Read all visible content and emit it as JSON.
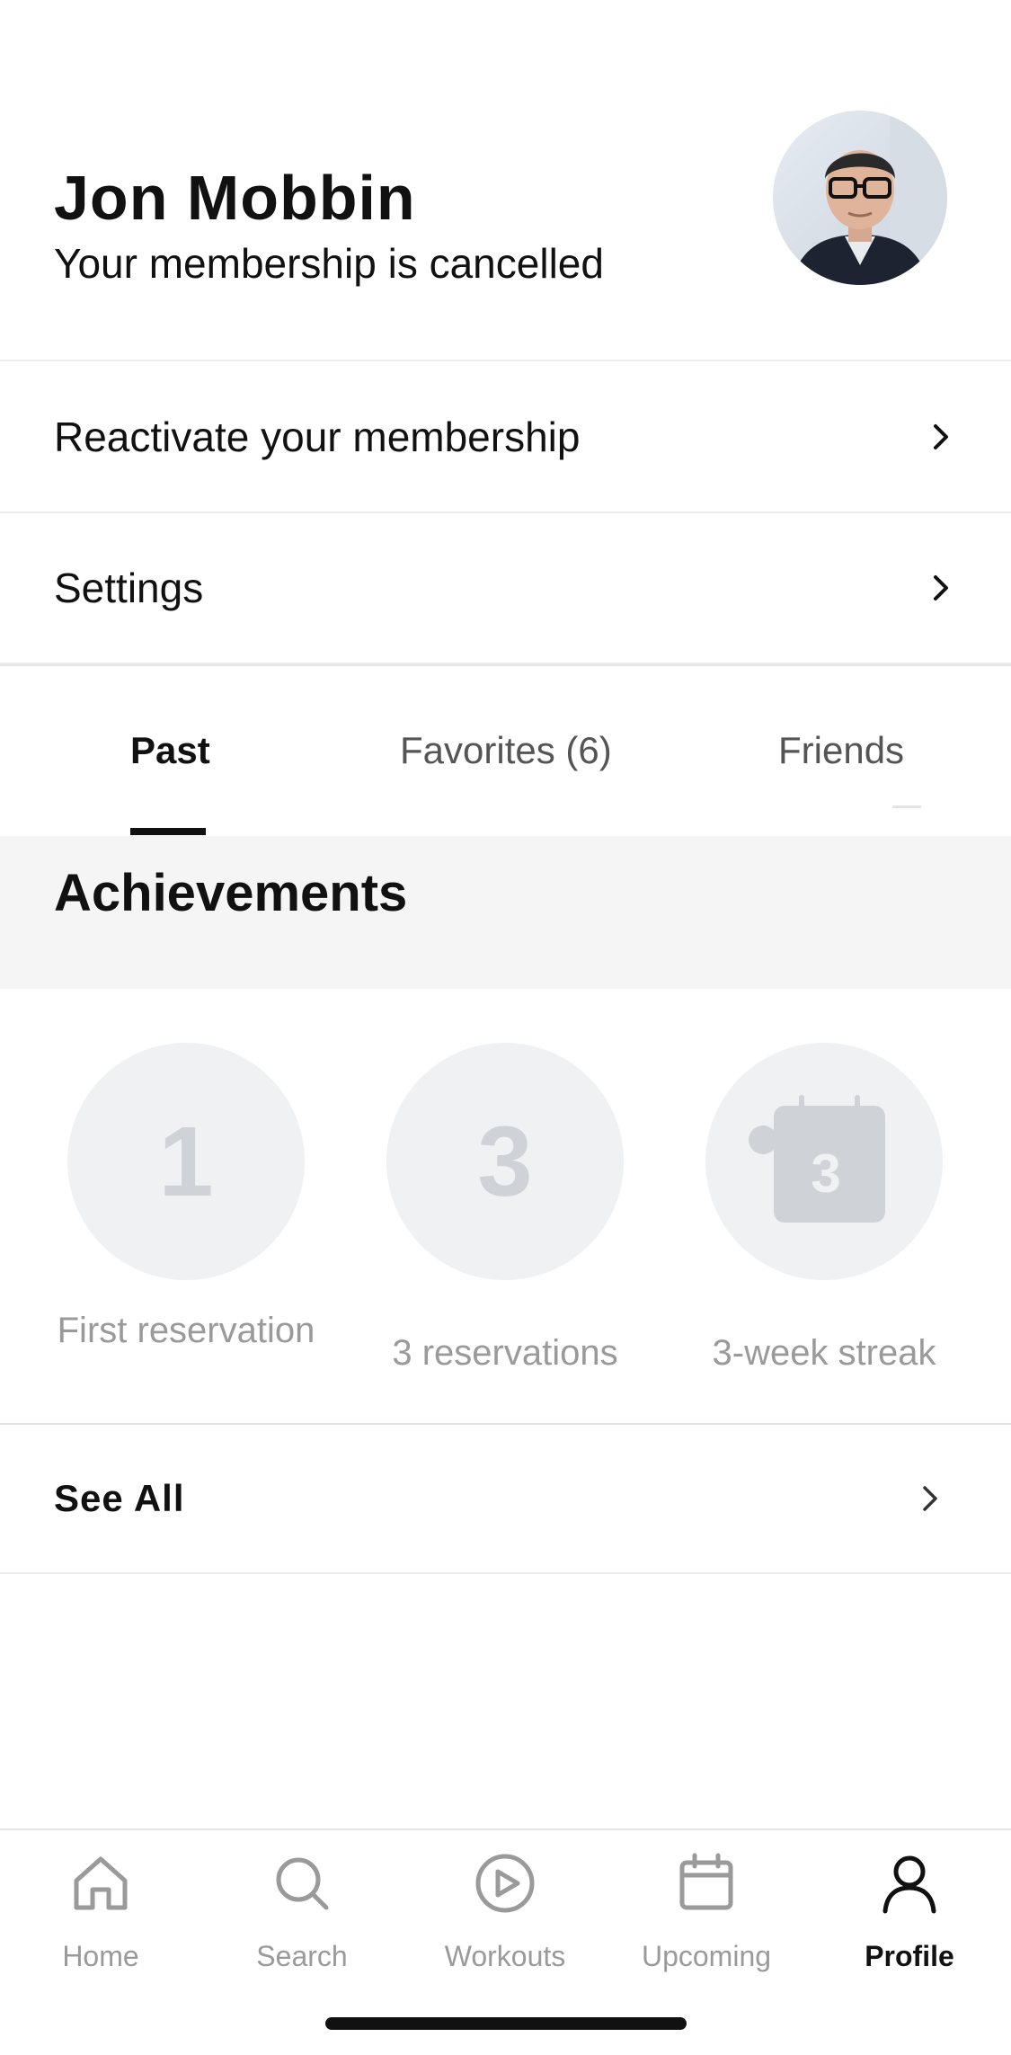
{
  "profile": {
    "name": "Jon Mobbin",
    "membership_status": "Your membership is cancelled",
    "avatar_icon": "user-photo"
  },
  "menu": {
    "reactivate_label": "Reactivate your membership",
    "settings_label": "Settings"
  },
  "tabs": [
    {
      "label": "Past",
      "active": true
    },
    {
      "label": "Favorites (6)",
      "active": false
    },
    {
      "label": "Friends",
      "active": false
    }
  ],
  "achievements": {
    "title": "Achievements",
    "items": [
      {
        "badge": "1",
        "label": "First reservation"
      },
      {
        "badge": "3",
        "label": "3 reservations"
      },
      {
        "badge": "3",
        "label": "3-week streak",
        "icon": "calendar-icon"
      }
    ],
    "see_all_label": "See All"
  },
  "nav": {
    "items": [
      {
        "label": "Home",
        "icon": "home-icon",
        "active": false
      },
      {
        "label": "Search",
        "icon": "search-icon",
        "active": false
      },
      {
        "label": "Workouts",
        "icon": "play-circle-icon",
        "active": false
      },
      {
        "label": "Upcoming",
        "icon": "calendar-icon",
        "active": false
      },
      {
        "label": "Profile",
        "icon": "person-icon",
        "active": true
      }
    ]
  },
  "colors": {
    "primary_text": "#111111",
    "muted_text": "#9a9a9a",
    "badge_bg": "#f0f1f2",
    "section_bg": "#f5f5f5"
  }
}
